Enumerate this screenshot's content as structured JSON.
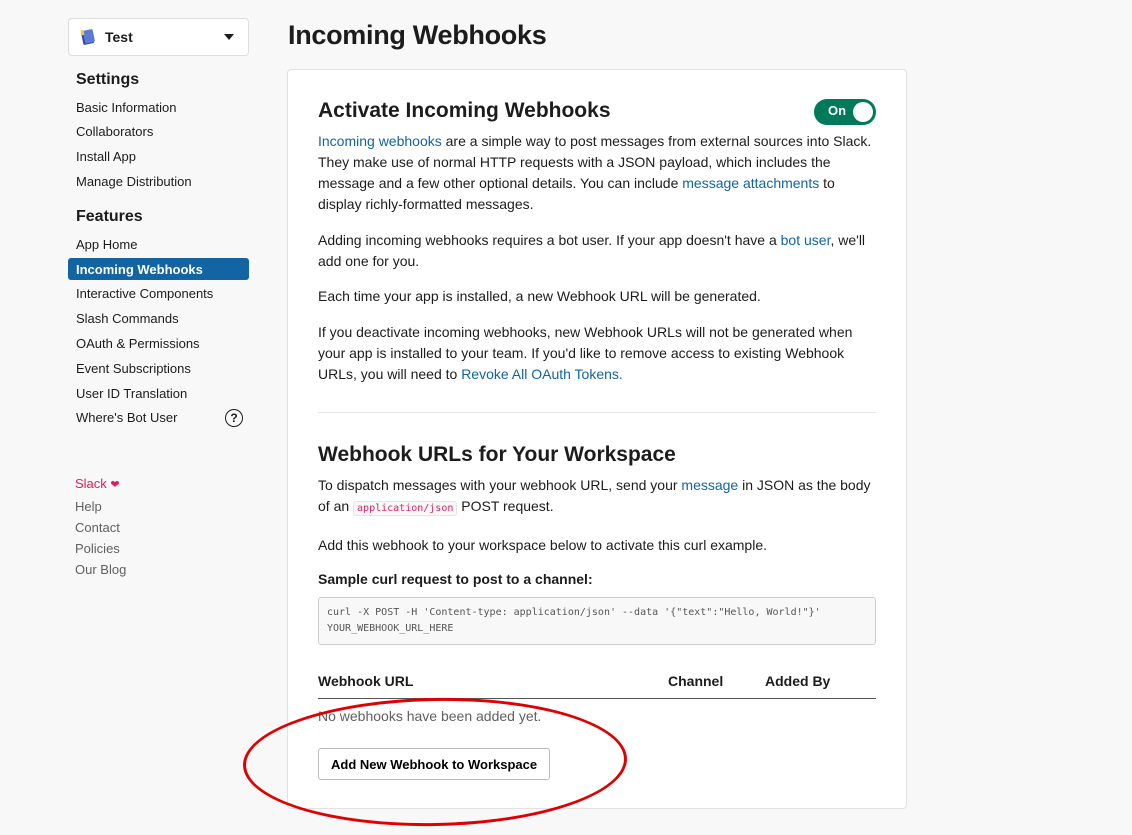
{
  "sidebar": {
    "app_name": "Test",
    "settings_heading": "Settings",
    "settings_items": [
      "Basic Information",
      "Collaborators",
      "Install App",
      "Manage Distribution"
    ],
    "features_heading": "Features",
    "features_items": [
      "App Home",
      "Incoming Webhooks",
      "Interactive Components",
      "Slash Commands",
      "OAuth & Permissions",
      "Event Subscriptions",
      "User ID Translation",
      "Where's Bot User"
    ],
    "active_item": "Incoming Webhooks",
    "footer": [
      "Slack",
      "Help",
      "Contact",
      "Policies",
      "Our Blog"
    ]
  },
  "main": {
    "page_title": "Incoming Webhooks",
    "activate": {
      "title": "Activate Incoming Webhooks",
      "toggle_label": "On",
      "p1_link": "Incoming webhooks",
      "p1_text1": " are a simple way to post messages from external sources into Slack. They make use of normal HTTP requests with a JSON payload, which includes the message and a few other optional details. You can include ",
      "p1_link2": "message attachments",
      "p1_text2": " to display richly-formatted messages.",
      "p2_text1": "Adding incoming webhooks requires a bot user. If your app doesn't have a ",
      "p2_link": "bot user",
      "p2_text2": ", we'll add one for you.",
      "p3": "Each time your app is installed, a new Webhook URL will be generated.",
      "p4_text": "If you deactivate incoming webhooks, new Webhook URLs will not be generated when your app is installed to your team. If you'd like to remove access to existing Webhook URLs, you will need to ",
      "p4_link": "Revoke All OAuth Tokens."
    },
    "webhooks": {
      "title": "Webhook URLs for Your Workspace",
      "p1_text1": "To dispatch messages with your webhook URL, send your ",
      "p1_link": "message",
      "p1_text2": " in JSON as the body of an ",
      "p1_code": "application/json",
      "p1_text3": " POST request.",
      "p2": "Add this webhook to your workspace below to activate this curl example.",
      "curl_label": "Sample curl request to post to a channel:",
      "curl_code": "curl -X POST -H 'Content-type: application/json' --data '{\"text\":\"Hello, World!\"}' YOUR_WEBHOOK_URL_HERE",
      "columns": [
        "Webhook URL",
        "Channel",
        "Added By"
      ],
      "empty_text": "No webhooks have been added yet.",
      "add_button": "Add New Webhook to Workspace"
    }
  },
  "colors": {
    "accent": "#1264a3",
    "toggle_on": "#007a5a",
    "annotation": "#e00000"
  },
  "icons": [
    "app-icon",
    "chevron-down-icon",
    "help-circle-icon",
    "heart-icon"
  ]
}
